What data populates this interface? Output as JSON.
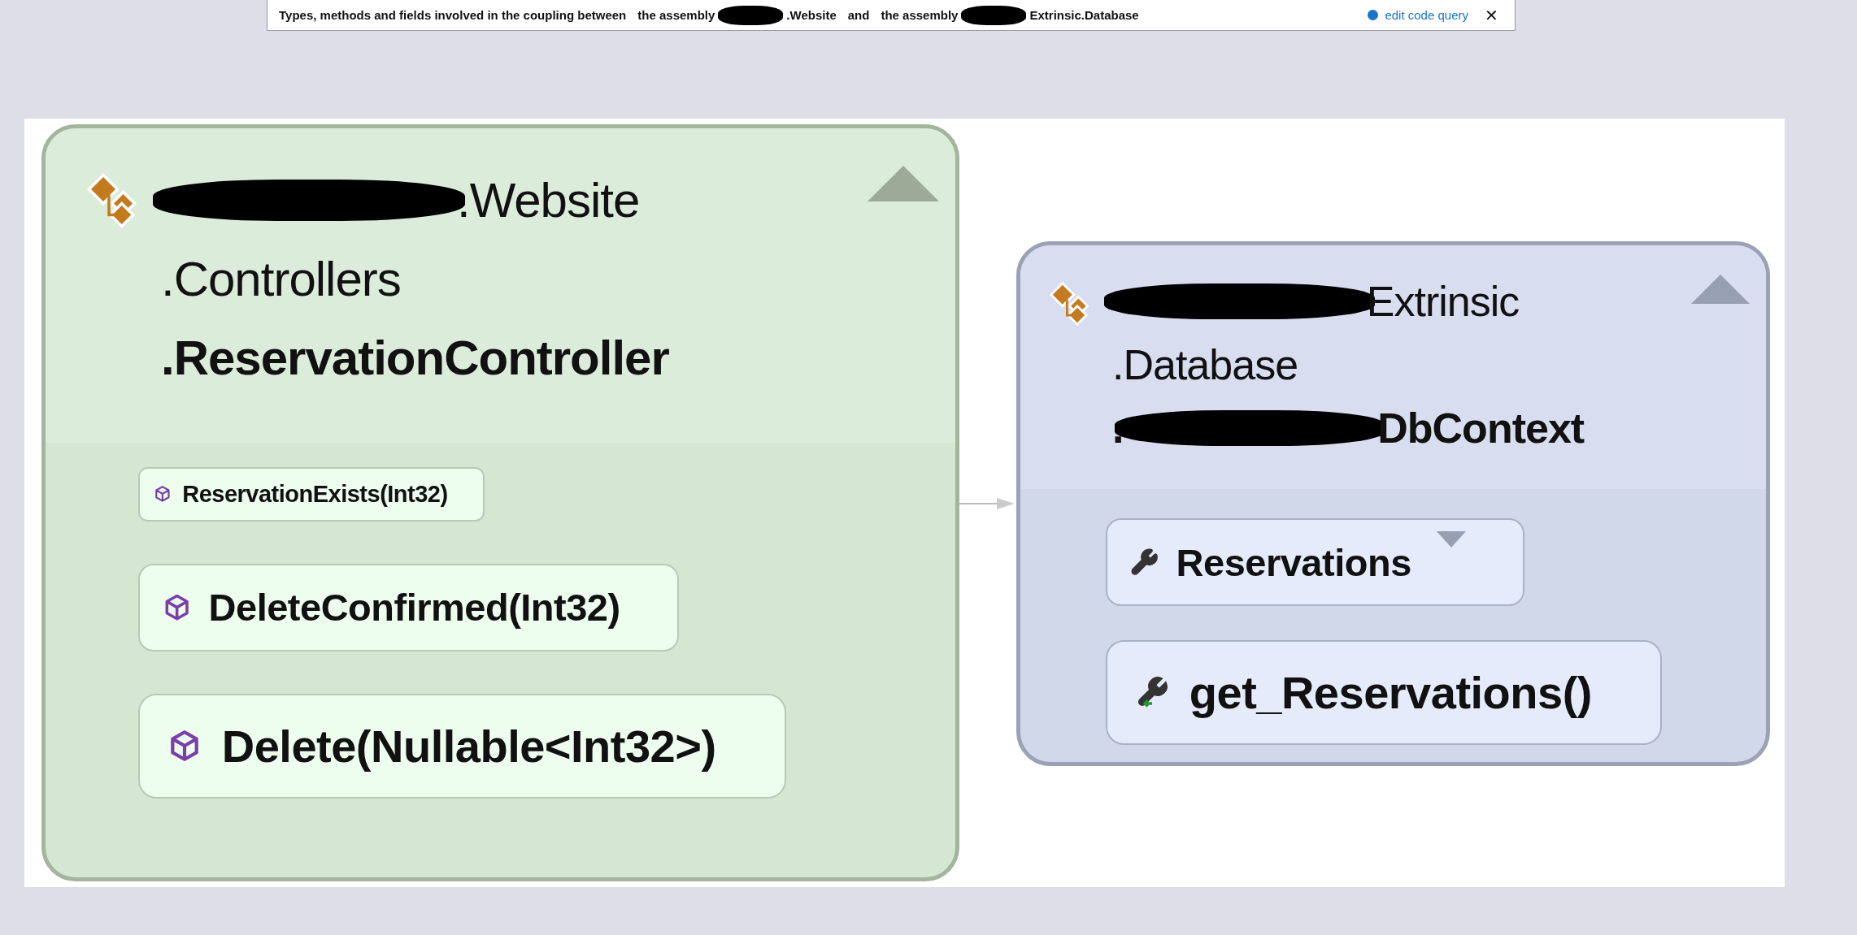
{
  "banner": {
    "parts": [
      {
        "kind": "text",
        "text": "Types, methods and fields involved in the coupling between"
      },
      {
        "kind": "text",
        "text": "the assembly"
      },
      {
        "kind": "redacted"
      },
      {
        "kind": "text",
        "text": ".Website"
      },
      {
        "kind": "text",
        "text": "and"
      },
      {
        "kind": "text",
        "text": "the assembly"
      },
      {
        "kind": "redacted"
      },
      {
        "kind": "text",
        "text": "Extrinsic.Database"
      }
    ],
    "link": "edit code query",
    "close": "✕"
  },
  "nodes": [
    {
      "kind": "caller",
      "expanded": true,
      "title": [
        {
          "bold": false,
          "parts": [
            {
              "kind": "redacted"
            },
            {
              "kind": "text",
              "text": ".Website"
            }
          ]
        },
        {
          "bold": false,
          "parts": [
            {
              "kind": "text",
              "text": ".Controllers"
            }
          ]
        },
        {
          "bold": true,
          "parts": [
            {
              "kind": "text",
              "text": ".ReservationController"
            }
          ]
        }
      ],
      "members": [
        {
          "kind": "method",
          "label": "ReservationExists(Int32)"
        },
        {
          "kind": "method",
          "label": "DeleteConfirmed(Int32)"
        },
        {
          "kind": "method",
          "label": "Delete(Nullable<Int32>)"
        }
      ]
    },
    {
      "kind": "callee",
      "expanded": true,
      "title": [
        {
          "bold": false,
          "parts": [
            {
              "kind": "redacted"
            },
            {
              "kind": "text",
              "text": "Extrinsic"
            }
          ]
        },
        {
          "bold": false,
          "parts": [
            {
              "kind": "text",
              "text": ".Database"
            }
          ]
        },
        {
          "bold": true,
          "parts": [
            {
              "kind": "text",
              "text": "."
            },
            {
              "kind": "redacted"
            },
            {
              "kind": "text",
              "text": "DbContext"
            }
          ]
        }
      ],
      "members": [
        {
          "kind": "property",
          "label": "Reservations",
          "expanded": false
        },
        {
          "kind": "getter",
          "label": "get_Reservations()"
        }
      ]
    }
  ]
}
